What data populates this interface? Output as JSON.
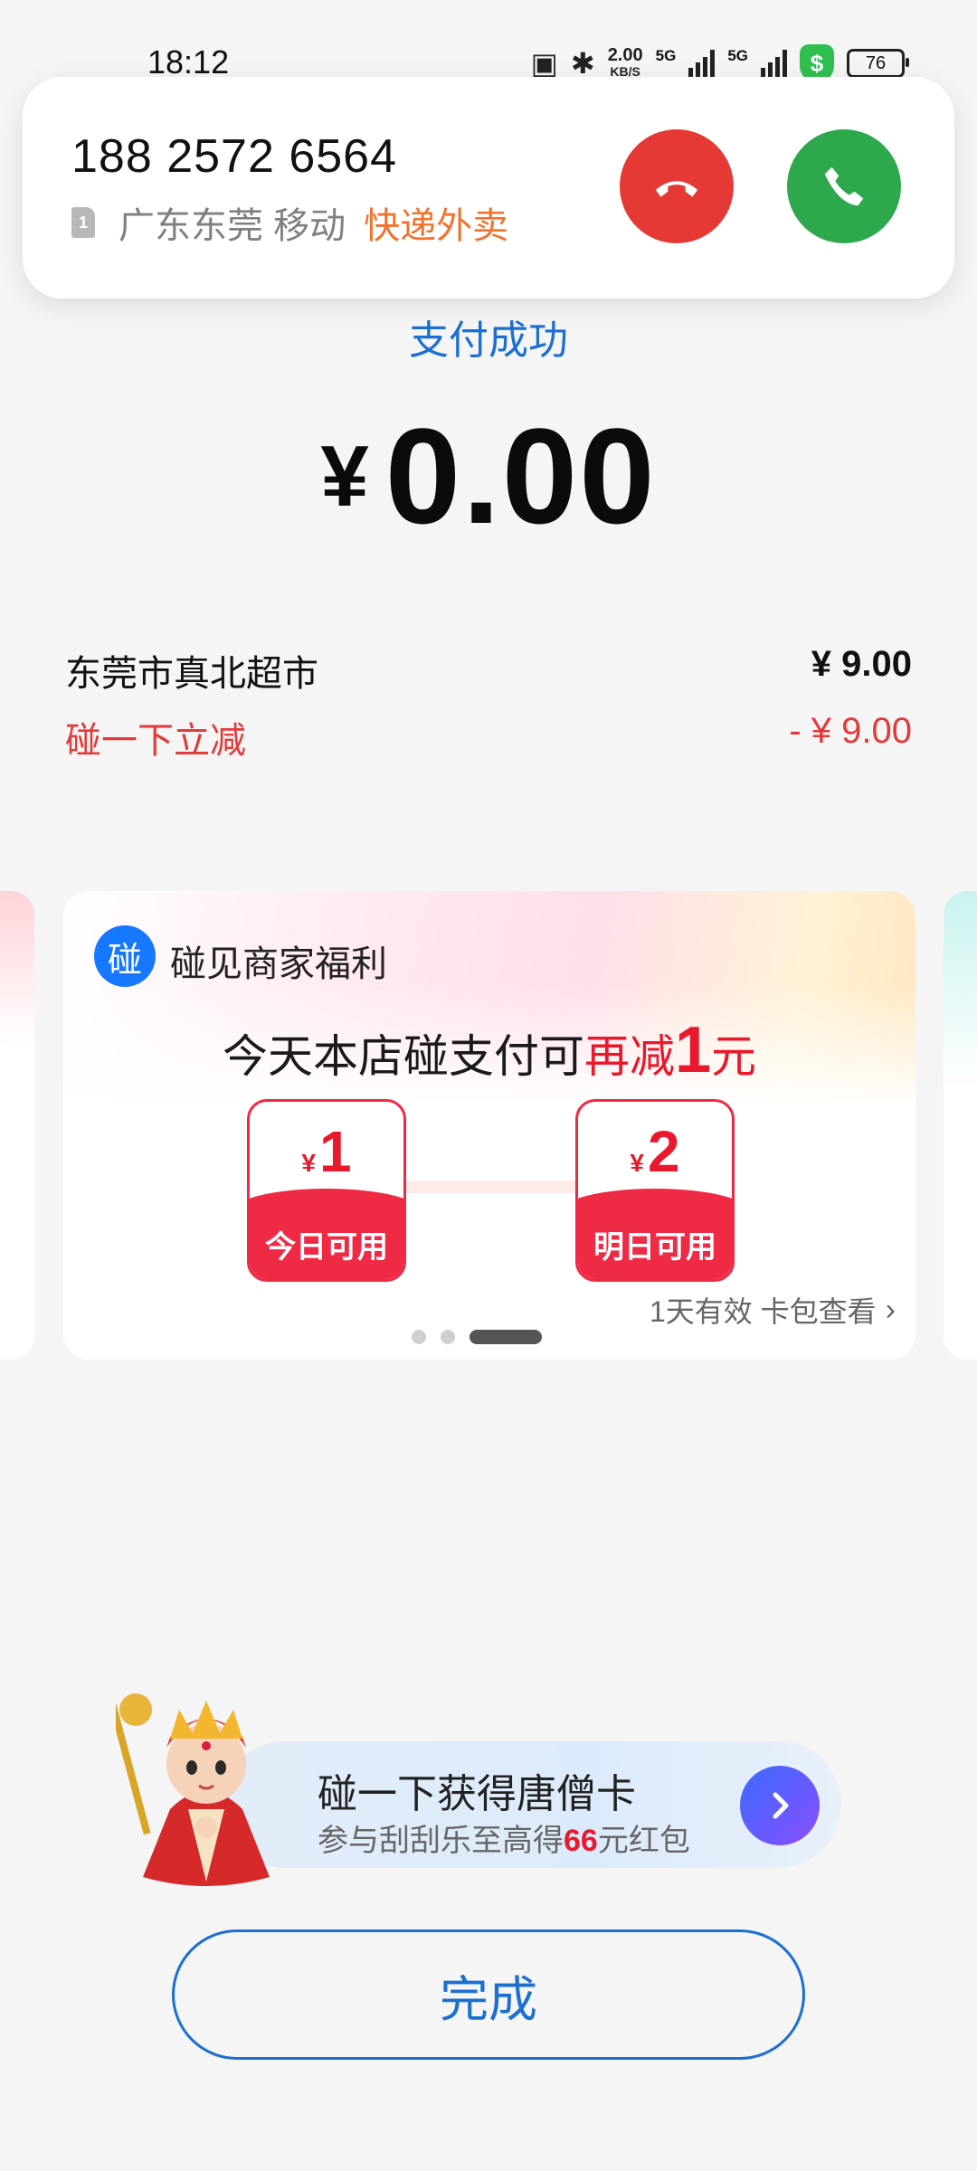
{
  "status_bar": {
    "time": "18:12",
    "net_speed_value": "2.00",
    "net_speed_unit": "KB/S",
    "network_type": "5G",
    "battery": "76"
  },
  "incoming_call": {
    "number": "188 2572 6564",
    "sim": "1",
    "location": "广东东莞 移动",
    "tag": "快递外卖"
  },
  "payment": {
    "status": "支付成功",
    "currency": "¥",
    "amount": "0.00"
  },
  "order": {
    "merchant": "东莞市真北超市",
    "price": "¥ 9.00",
    "discount_label": "碰一下立减",
    "discount_value": "- ¥ 9.00"
  },
  "benefit_card": {
    "logo_char": "碰",
    "title": "碰见商家福利",
    "promo_prefix": "今天本店碰支付可",
    "promo_red": "再减",
    "promo_amount": "1",
    "promo_unit": "元",
    "coupons": [
      {
        "currency": "¥",
        "value": "1",
        "label": "今日可用"
      },
      {
        "currency": "¥",
        "value": "2",
        "label": "明日可用"
      }
    ],
    "footer": "1天有效 卡包查看",
    "page_index": 3,
    "page_count": 3
  },
  "promo_banner": {
    "title": "碰一下获得唐僧卡",
    "sub_prefix": "参与刮刮乐至高得",
    "sub_highlight": "66",
    "sub_suffix": "元红包"
  },
  "done_button": "完成",
  "colors": {
    "accent_blue": "#1b6fd1",
    "discount_red": "#e23a3a",
    "coupon_red": "#ef2a45",
    "decline_red": "#e53935",
    "answer_green": "#2ea84d",
    "tag_orange": "#f0742e"
  },
  "icons": {
    "nfc": "nfc-icon",
    "bluetooth": "bluetooth-icon",
    "signal": "signal-icon",
    "security": "shield-icon",
    "battery": "battery-icon",
    "decline": "phone-hangup-icon",
    "answer": "phone-answer-icon",
    "arrow": "chevron-right-icon"
  }
}
